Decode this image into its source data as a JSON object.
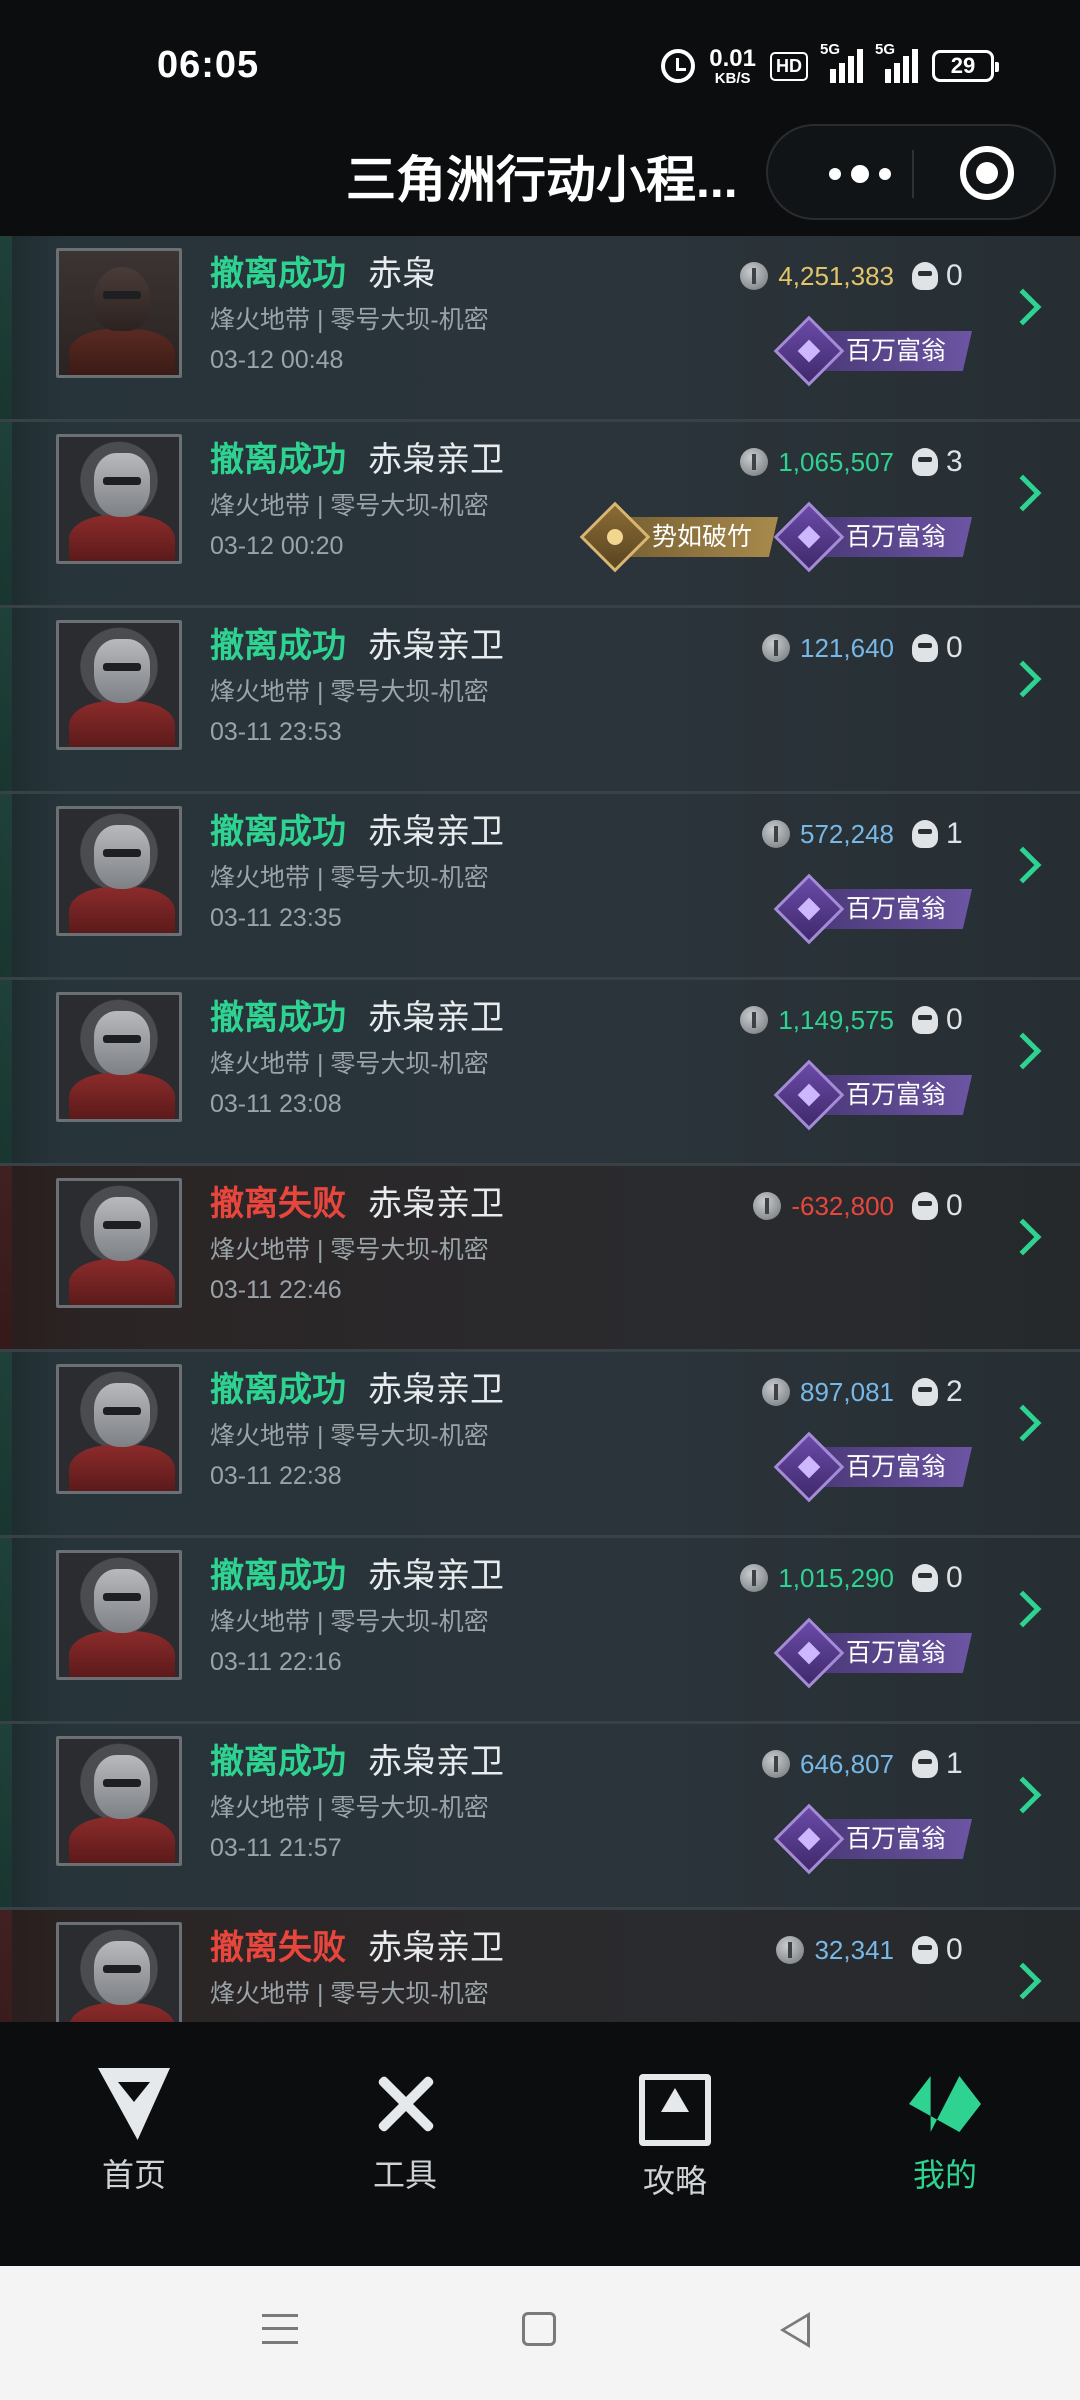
{
  "status_bar": {
    "time": "06:05",
    "net_speed_value": "0.01",
    "net_speed_unit": "KB/S",
    "hd": "HD",
    "sim1": "5G",
    "sim2": "5G",
    "battery": "29"
  },
  "header": {
    "title": "三角洲行动小程...",
    "more_icon": "more-dots-icon",
    "close_icon": "target-close-icon"
  },
  "records": [
    {
      "status": "撤离成功",
      "result": "success",
      "operator": "赤枭",
      "map": "烽火地带 | 零号大坝-机密",
      "date": "03-12 00:48",
      "value": "4,251,383",
      "value_color": "gold",
      "kills": "0",
      "badges": [
        "百万富翁"
      ]
    },
    {
      "status": "撤离成功",
      "result": "success",
      "operator": "赤枭亲卫",
      "map": "烽火地带 | 零号大坝-机密",
      "date": "03-12 00:20",
      "value": "1,065,507",
      "value_color": "green",
      "kills": "3",
      "badges": [
        "势如破竹",
        "百万富翁"
      ]
    },
    {
      "status": "撤离成功",
      "result": "success",
      "operator": "赤枭亲卫",
      "map": "烽火地带 | 零号大坝-机密",
      "date": "03-11 23:53",
      "value": "121,640",
      "value_color": "blue",
      "kills": "0",
      "badges": []
    },
    {
      "status": "撤离成功",
      "result": "success",
      "operator": "赤枭亲卫",
      "map": "烽火地带 | 零号大坝-机密",
      "date": "03-11 23:35",
      "value": "572,248",
      "value_color": "blue",
      "kills": "1",
      "badges": [
        "百万富翁"
      ]
    },
    {
      "status": "撤离成功",
      "result": "success",
      "operator": "赤枭亲卫",
      "map": "烽火地带 | 零号大坝-机密",
      "date": "03-11 23:08",
      "value": "1,149,575",
      "value_color": "green",
      "kills": "0",
      "badges": [
        "百万富翁"
      ]
    },
    {
      "status": "撤离失败",
      "result": "fail",
      "operator": "赤枭亲卫",
      "map": "烽火地带 | 零号大坝-机密",
      "date": "03-11 22:46",
      "value": "-632,800",
      "value_color": "red",
      "kills": "0",
      "badges": []
    },
    {
      "status": "撤离成功",
      "result": "success",
      "operator": "赤枭亲卫",
      "map": "烽火地带 | 零号大坝-机密",
      "date": "03-11 22:38",
      "value": "897,081",
      "value_color": "blue",
      "kills": "2",
      "badges": [
        "百万富翁"
      ]
    },
    {
      "status": "撤离成功",
      "result": "success",
      "operator": "赤枭亲卫",
      "map": "烽火地带 | 零号大坝-机密",
      "date": "03-11 22:16",
      "value": "1,015,290",
      "value_color": "green",
      "kills": "0",
      "badges": [
        "百万富翁"
      ]
    },
    {
      "status": "撤离成功",
      "result": "success",
      "operator": "赤枭亲卫",
      "map": "烽火地带 | 零号大坝-机密",
      "date": "03-11 21:57",
      "value": "646,807",
      "value_color": "blue",
      "kills": "1",
      "badges": [
        "百万富翁"
      ]
    },
    {
      "status": "撤离失败",
      "result": "fail",
      "operator": "赤枭亲卫",
      "map": "烽火地带 | 零号大坝-机密",
      "date": "",
      "value": "32,341",
      "value_color": "blue",
      "kills": "0",
      "badges": []
    }
  ],
  "tabbar": {
    "items": [
      {
        "label": "首页",
        "icon": "home-logo-icon",
        "active": false
      },
      {
        "label": "工具",
        "icon": "tools-icon",
        "active": false
      },
      {
        "label": "攻略",
        "icon": "guide-monitor-icon",
        "active": false
      },
      {
        "label": "我的",
        "icon": "profile-icon",
        "active": true
      }
    ]
  },
  "colors": {
    "success": "#2fd391",
    "fail": "#e8463d",
    "gold_value": "#e3c46a",
    "blue_value": "#78b8e6",
    "accent_purple": "#6c55a3",
    "background": "#0b0d0e"
  }
}
